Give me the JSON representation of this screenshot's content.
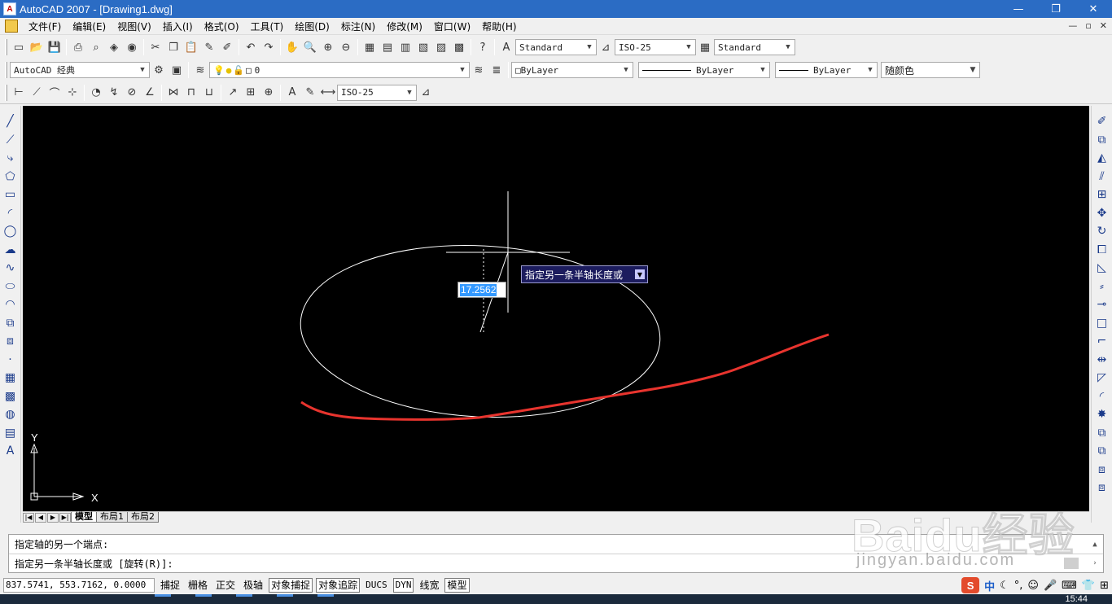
{
  "window": {
    "title": "AutoCAD 2007 - [Drawing1.dwg]",
    "icon": "autocad-icon",
    "buttons": [
      "—",
      "❐",
      "✕"
    ]
  },
  "menu": {
    "items": [
      "文件(F)",
      "编辑(E)",
      "视图(V)",
      "插入(I)",
      "格式(O)",
      "工具(T)",
      "绘图(D)",
      "标注(N)",
      "修改(M)",
      "窗口(W)",
      "帮助(H)"
    ],
    "mdi_buttons": [
      "—",
      "▫",
      "✕"
    ]
  },
  "toolbar1": {
    "text_style": "Standard",
    "dim_style": "ISO-25",
    "table_style": "Standard"
  },
  "toolbar2": {
    "workspace": "AutoCAD 经典",
    "layer": "0",
    "color": "ByLayer",
    "linetype": "ByLayer",
    "lineweight": "ByLayer",
    "plot_style": "随颜色"
  },
  "toolbar3": {
    "dim_style": "ISO-25"
  },
  "canvas": {
    "background": "#000000",
    "ellipse_color": "#ffffff",
    "curve_color": "#e8342e",
    "ucs_x_label": "X",
    "ucs_y_label": "Y"
  },
  "dynamic_input": {
    "value": "17.2562",
    "tooltip": "指定另一条半轴长度或"
  },
  "layout_tabs": {
    "tabs": [
      "模型",
      "布局1",
      "布局2"
    ],
    "active": "模型"
  },
  "command": {
    "line1": "指定轴的另一个端点:",
    "line2": "指定另一条半轴长度或 [旋转(R)]:"
  },
  "status": {
    "coords": "837.5741, 553.7162, 0.0000",
    "buttons": [
      {
        "label": "捕捉",
        "on": false
      },
      {
        "label": "栅格",
        "on": false
      },
      {
        "label": "正交",
        "on": false
      },
      {
        "label": "极轴",
        "on": false
      },
      {
        "label": "对象捕捉",
        "on": true
      },
      {
        "label": "对象追踪",
        "on": true
      },
      {
        "label": "DUCS",
        "on": false
      },
      {
        "label": "DYN",
        "on": true
      },
      {
        "label": "线宽",
        "on": false
      },
      {
        "label": "模型",
        "on": true
      }
    ],
    "tray": {
      "ime_logo": "S",
      "ime_mode": "中",
      "icons": [
        "moon-icon",
        "punctuation-icon",
        "emoji-icon",
        "mic-icon",
        "keyboard-icon",
        "shirt-icon",
        "grid-icon"
      ]
    }
  },
  "taskbar": {
    "clock": "15:44"
  },
  "watermark": {
    "brand": "Baidu经验",
    "url": "jingyan.baidu.com"
  }
}
